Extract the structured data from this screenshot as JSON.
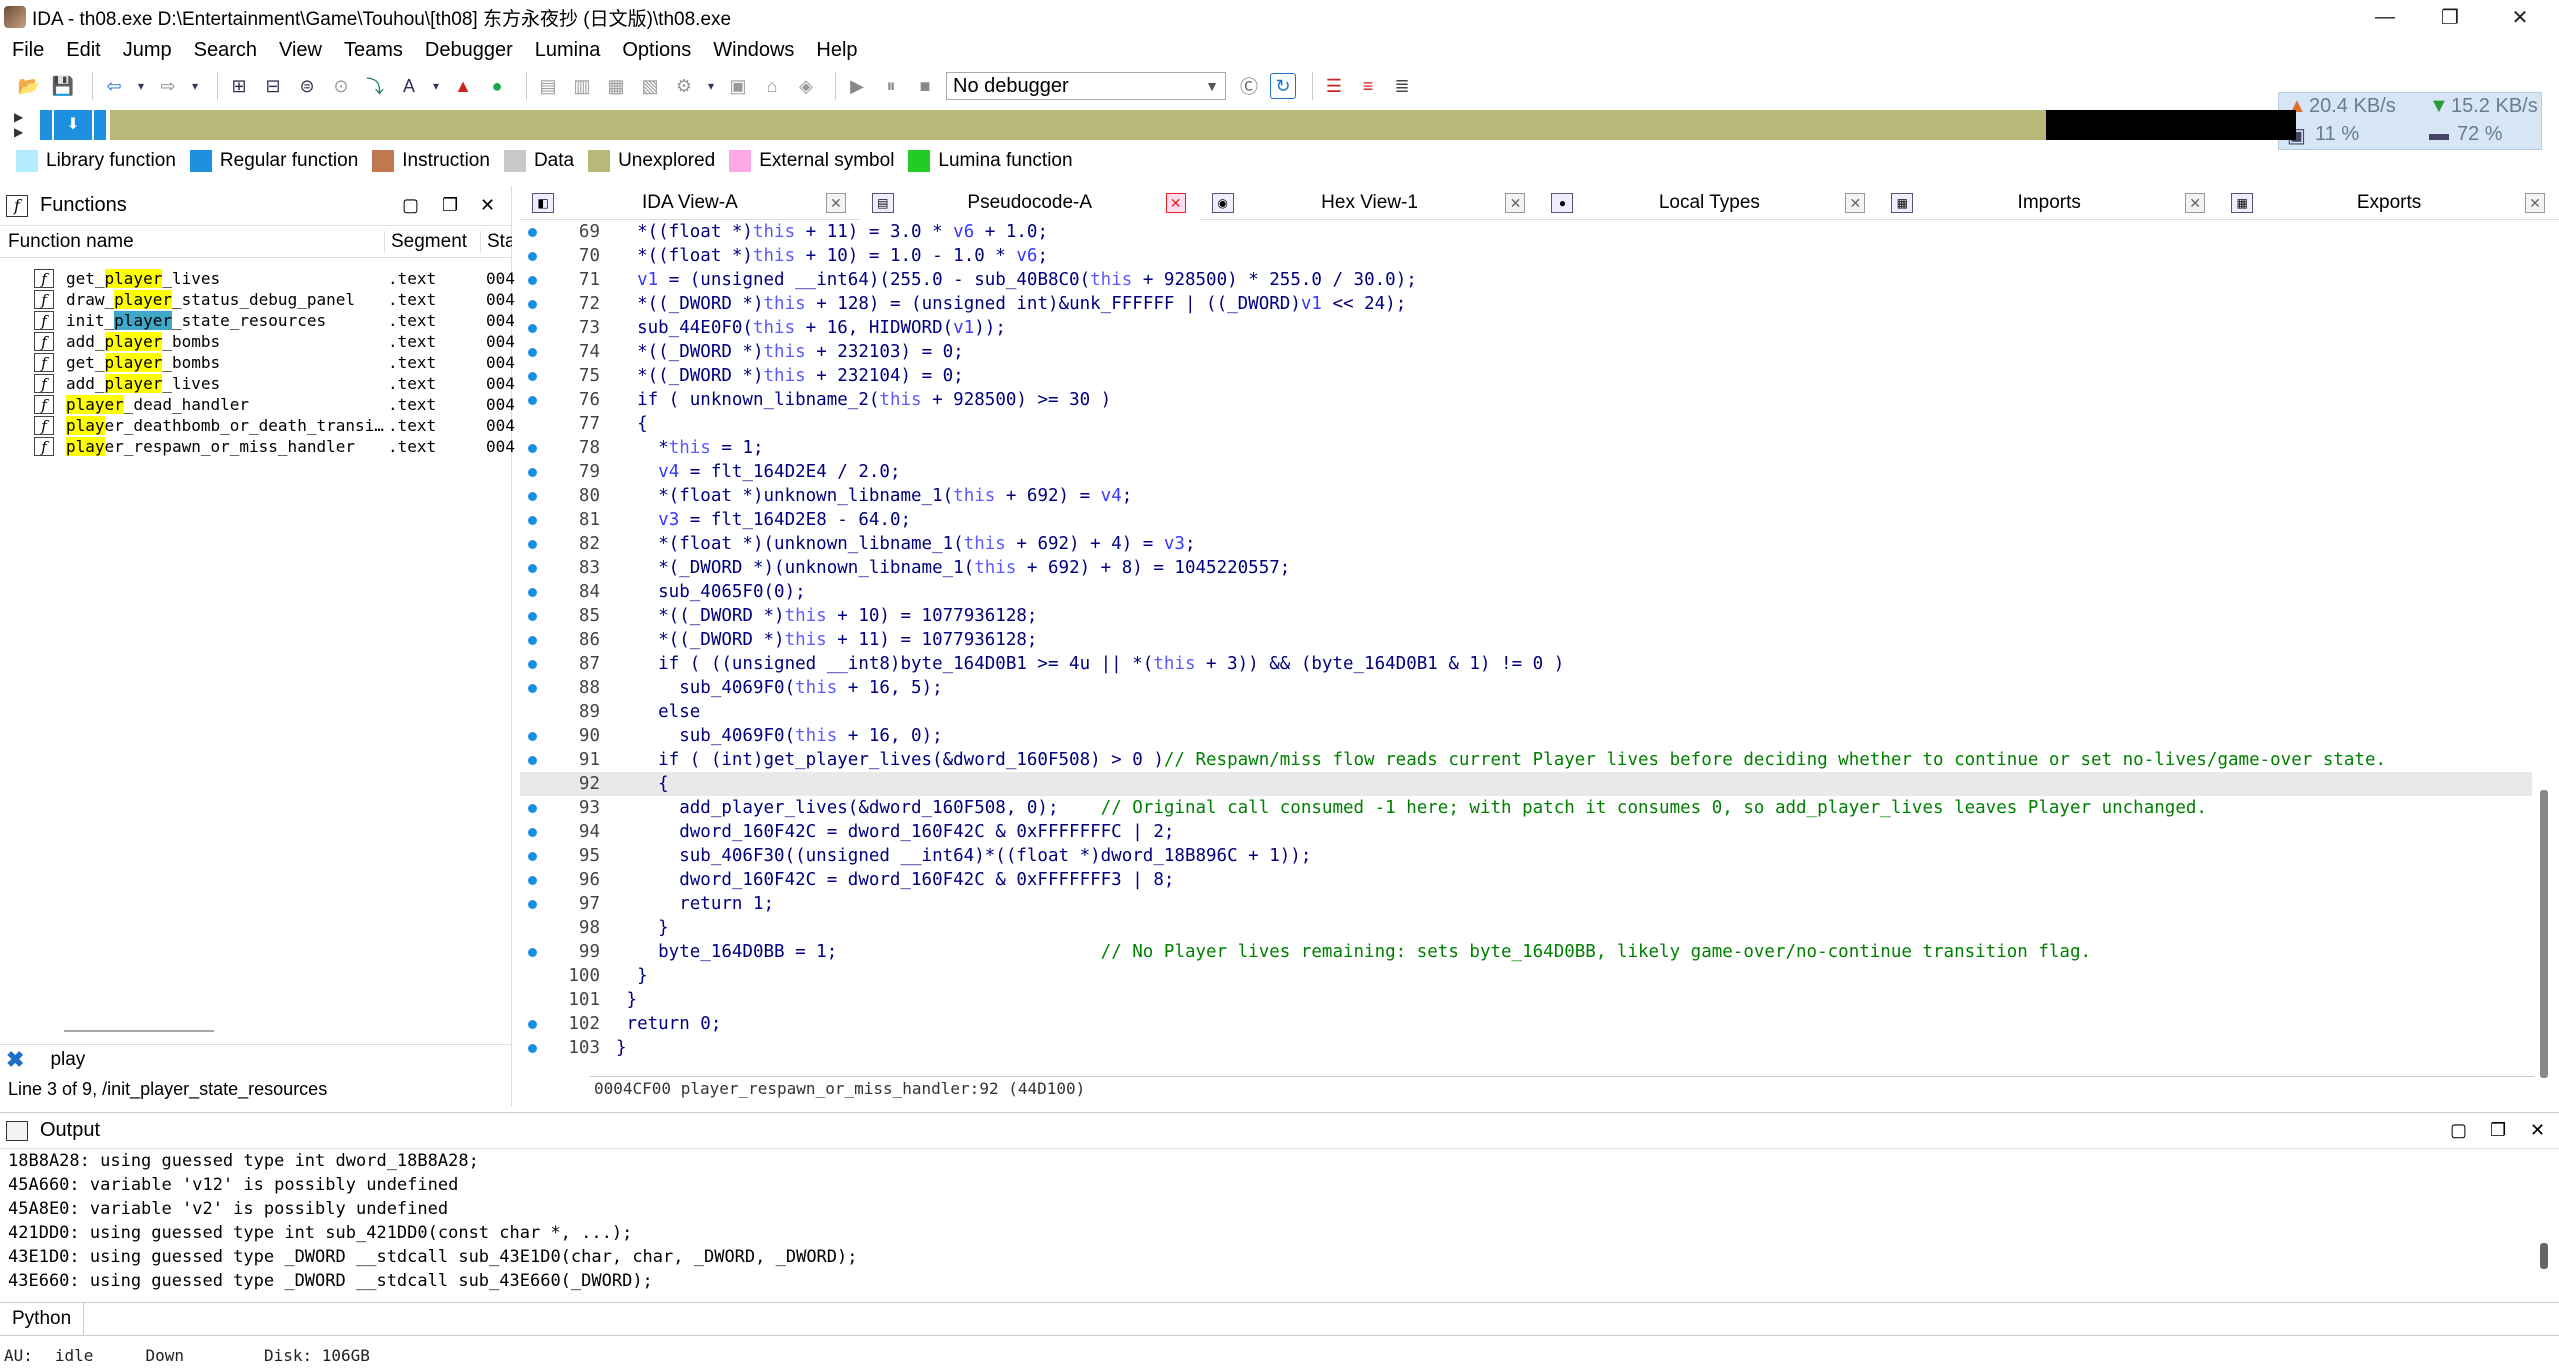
{
  "window": {
    "title": "IDA - th08.exe D:\\Entertainment\\Game\\Touhou\\[th08] 东方永夜抄 (日文版)\\th08.exe",
    "min_glyph": "—",
    "max_glyph": "❐",
    "close_glyph": "✕"
  },
  "menu": [
    "File",
    "Edit",
    "Jump",
    "Search",
    "View",
    "Teams",
    "Debugger",
    "Lumina",
    "Options",
    "Windows",
    "Help"
  ],
  "toolbar": {
    "debugger_selected": "No debugger"
  },
  "net": {
    "up": "20.4 KB/s",
    "down": "15.2 KB/s",
    "cpu": "11 %",
    "mem": "72 %"
  },
  "legend": [
    {
      "label": "Library function",
      "color": "#b3ecff"
    },
    {
      "label": "Regular function",
      "color": "#1e90e0"
    },
    {
      "label": "Instruction",
      "color": "#c07850"
    },
    {
      "label": "Data",
      "color": "#c8c8c8"
    },
    {
      "label": "Unexplored",
      "color": "#b8b878"
    },
    {
      "label": "External symbol",
      "color": "#ffa8e8"
    },
    {
      "label": "Lumina function",
      "color": "#22cc22"
    }
  ],
  "functions": {
    "title": "Functions",
    "col_name": "Function name",
    "col_segment": "Segment",
    "col_start": "Sta",
    "rows": [
      {
        "pre": "get_",
        "hl": "player",
        "post": "_lives",
        "seg": ".text",
        "start": "004",
        "sel": false
      },
      {
        "pre": "draw_",
        "hl": "player",
        "post": "_status_debug_panel",
        "seg": ".text",
        "start": "004",
        "sel": false
      },
      {
        "pre": "init_",
        "hl": "player",
        "post": "_state_resources",
        "seg": ".text",
        "start": "004",
        "sel": true
      },
      {
        "pre": "add_",
        "hl": "player",
        "post": "_bombs",
        "seg": ".text",
        "start": "004",
        "sel": false
      },
      {
        "pre": "get_",
        "hl": "player",
        "post": "_bombs",
        "seg": ".text",
        "start": "004",
        "sel": false
      },
      {
        "pre": "add_",
        "hl": "player",
        "post": "_lives",
        "seg": ".text",
        "start": "004",
        "sel": false
      },
      {
        "pre": "",
        "hl": "player",
        "post": "_dead_handler",
        "seg": ".text",
        "start": "004",
        "sel": false
      },
      {
        "pre": "",
        "hl": "play",
        "post": "er_deathbomb_or_death_transi…",
        "seg": ".text",
        "start": "004",
        "sel": false
      },
      {
        "pre": "",
        "hl": "play",
        "post": "er_respawn_or_miss_handler",
        "seg": ".text",
        "start": "004",
        "sel": false
      }
    ],
    "filter": "play",
    "status": "Line 3 of 9, /init_player_state_resources"
  },
  "tabs": [
    {
      "label": "IDA View-A",
      "active": false
    },
    {
      "label": "Pseudocode-A",
      "active": true
    },
    {
      "label": "Hex View-1",
      "active": false
    },
    {
      "label": "Local Types",
      "active": false
    },
    {
      "label": "Imports",
      "active": false
    },
    {
      "label": "Exports",
      "active": false
    }
  ],
  "code_lines": [
    {
      "n": "69",
      "dot": true,
      "t": "  *((float *)this + 11) = 3.0 * v6 + 1.0;"
    },
    {
      "n": "70",
      "dot": true,
      "t": "  *((float *)this + 10) = 1.0 - 1.0 * v6;"
    },
    {
      "n": "71",
      "dot": true,
      "t": "  v1 = (unsigned __int64)(255.0 - sub_40B8C0(this + 928500) * 255.0 / 30.0);"
    },
    {
      "n": "72",
      "dot": true,
      "t": "  *((_DWORD *)this + 128) = (unsigned int)&unk_FFFFFF | ((_DWORD)v1 << 24);"
    },
    {
      "n": "73",
      "dot": true,
      "t": "  sub_44E0F0(this + 16, HIDWORD(v1));"
    },
    {
      "n": "74",
      "dot": true,
      "t": "  *((_DWORD *)this + 232103) = 0;"
    },
    {
      "n": "75",
      "dot": true,
      "t": "  *((_DWORD *)this + 232104) = 0;"
    },
    {
      "n": "76",
      "dot": true,
      "t": "  if ( unknown_libname_2(this + 928500) >= 30 )"
    },
    {
      "n": "77",
      "dot": false,
      "t": "  {"
    },
    {
      "n": "78",
      "dot": true,
      "t": "    *this = 1;"
    },
    {
      "n": "79",
      "dot": true,
      "t": "    v4 = flt_164D2E4 / 2.0;"
    },
    {
      "n": "80",
      "dot": true,
      "t": "    *(float *)unknown_libname_1(this + 692) = v4;"
    },
    {
      "n": "81",
      "dot": true,
      "t": "    v3 = flt_164D2E8 - 64.0;"
    },
    {
      "n": "82",
      "dot": true,
      "t": "    *(float *)(unknown_libname_1(this + 692) + 4) = v3;"
    },
    {
      "n": "83",
      "dot": true,
      "t": "    *(_DWORD *)(unknown_libname_1(this + 692) + 8) = 1045220557;"
    },
    {
      "n": "84",
      "dot": true,
      "t": "    sub_4065F0(0);"
    },
    {
      "n": "85",
      "dot": true,
      "t": "    *((_DWORD *)this + 10) = 1077936128;"
    },
    {
      "n": "86",
      "dot": true,
      "t": "    *((_DWORD *)this + 11) = 1077936128;"
    },
    {
      "n": "87",
      "dot": true,
      "t": "    if ( ((unsigned __int8)byte_164D0B1 >= 4u || *(this + 3)) && (byte_164D0B1 & 1) != 0 )"
    },
    {
      "n": "88",
      "dot": true,
      "t": "      sub_4069F0(this + 16, 5);"
    },
    {
      "n": "89",
      "dot": false,
      "t": "    else"
    },
    {
      "n": "90",
      "dot": true,
      "t": "      sub_4069F0(this + 16, 0);"
    },
    {
      "n": "91",
      "dot": true,
      "t": "    if ( (int)get_player_lives(&dword_160F508) > 0 )",
      "c": "// Respawn/miss flow reads current Player lives before deciding whether to continue or set no-lives/game-over state."
    },
    {
      "n": "92",
      "dot": false,
      "t": "    {",
      "cur": true
    },
    {
      "n": "93",
      "dot": true,
      "t": "      add_player_lives(&dword_160F508, 0);    ",
      "c": "// Original call consumed -1 here; with patch it consumes 0, so add_player_lives leaves Player unchanged."
    },
    {
      "n": "94",
      "dot": true,
      "t": "      dword_160F42C = dword_160F42C & 0xFFFFFFFC | 2;"
    },
    {
      "n": "95",
      "dot": true,
      "t": "      sub_406F30((unsigned __int64)*((float *)dword_18B896C + 1));"
    },
    {
      "n": "96",
      "dot": true,
      "t": "      dword_160F42C = dword_160F42C & 0xFFFFFFF3 | 8;"
    },
    {
      "n": "97",
      "dot": true,
      "t": "      return 1;"
    },
    {
      "n": "98",
      "dot": false,
      "t": "    }"
    },
    {
      "n": "99",
      "dot": true,
      "t": "    byte_164D0BB = 1;                         ",
      "c": "// No Player lives remaining: sets byte_164D0BB, likely game-over/no-continue transition flag."
    },
    {
      "n": "100",
      "dot": false,
      "t": "  }"
    },
    {
      "n": "101",
      "dot": false,
      "t": " }"
    },
    {
      "n": "102",
      "dot": true,
      "t": " return 0;"
    },
    {
      "n": "103",
      "dot": true,
      "t": "}"
    }
  ],
  "code_status": "0004CF00 player_respawn_or_miss_handler:92 (44D100)",
  "output": {
    "title": "Output",
    "lines": [
      "18B8A28: using guessed type int dword_18B8A28;",
      "45A660: variable 'v12' is possibly undefined",
      "45A8E0: variable 'v2' is possibly undefined",
      "421DD0: using guessed type int sub_421DD0(const char *, ...);",
      "43E1D0: using guessed type _DWORD __stdcall sub_43E1D0(char, char, _DWORD, _DWORD);",
      "43E660: using guessed type _DWORD __stdcall sub_43E660(_DWORD);"
    ],
    "python_label": "Python"
  },
  "status": {
    "au_label": "AU:",
    "au_state": "idle",
    "dir": "Down",
    "disk": "Disk: 106GB"
  }
}
